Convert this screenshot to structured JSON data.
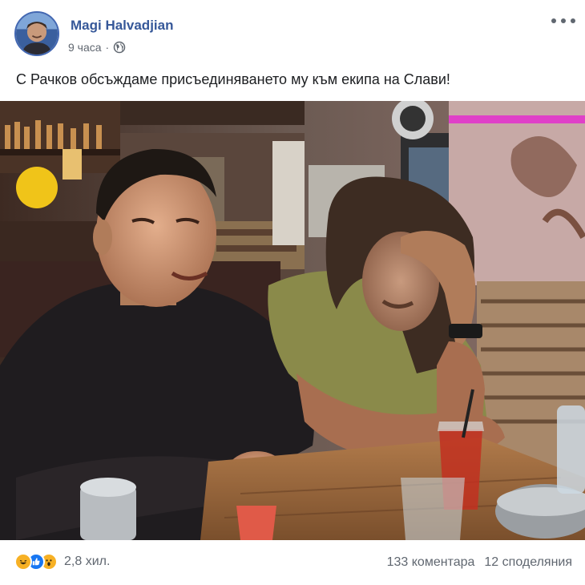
{
  "post": {
    "author": "Magi Halvadjian",
    "time": "9 часа",
    "separator": "·",
    "privacy_icon": "globe-icon",
    "more_icon": "ellipsis-icon",
    "text": "С Рачков обсъждаме присъединяването му към екипа на Слави!"
  },
  "footer": {
    "reactions": [
      "haha-icon",
      "like-icon",
      "wow-icon"
    ],
    "reaction_count": "2,8 хил.",
    "comments": "133 коментара",
    "shares": "12 споделяния"
  },
  "colors": {
    "author_link": "#365899",
    "secondary_text": "#606770",
    "like_blue": "#1877f2",
    "reaction_yellow": "#f7b125",
    "neon_pink": "#e040c8"
  }
}
